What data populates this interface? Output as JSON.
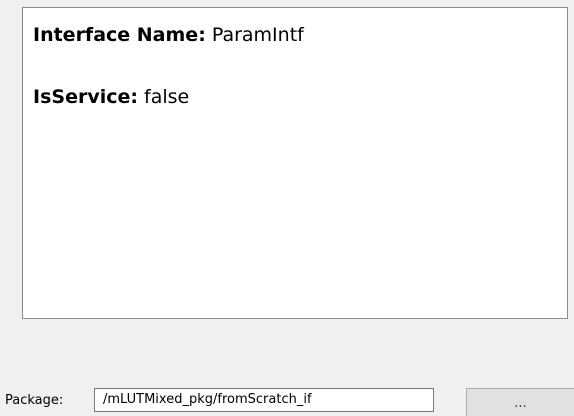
{
  "interface_info": {
    "name_key": "Interface Name:",
    "name_value": "ParamIntf",
    "service_key": "IsService:",
    "service_value": "false"
  },
  "package": {
    "label": "Package:",
    "value": "/mLUTMixed_pkg/fromScratch_if",
    "browse_label": "..."
  }
}
